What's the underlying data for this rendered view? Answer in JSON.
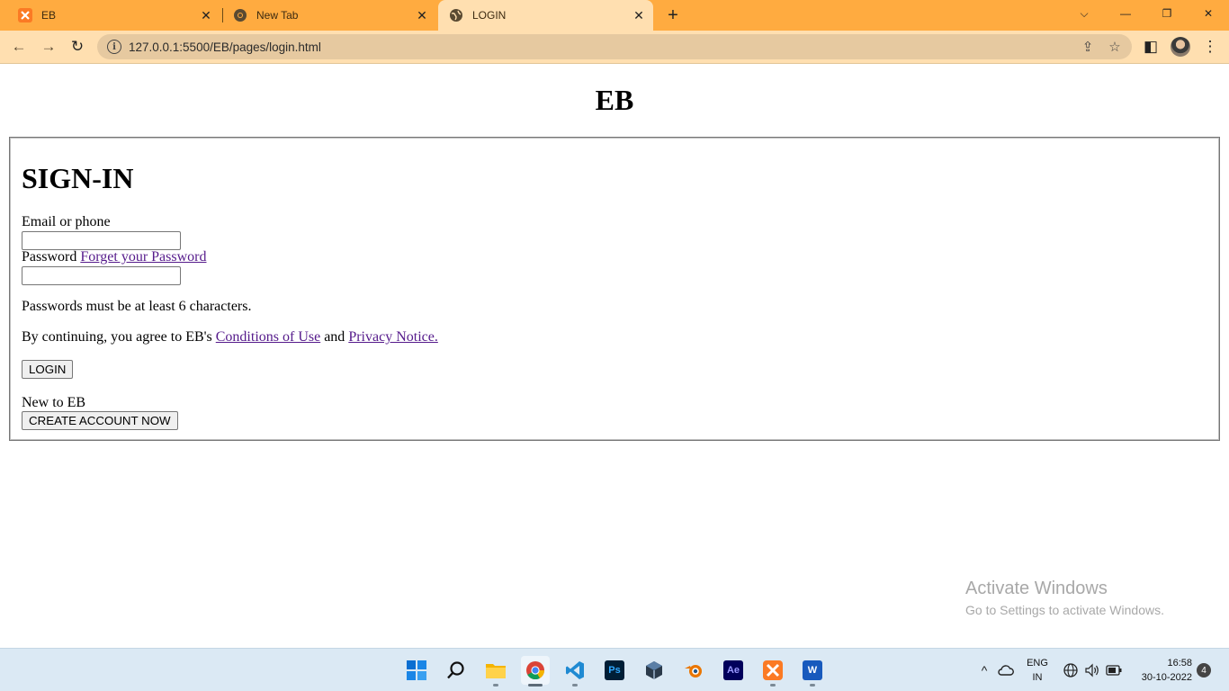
{
  "browser": {
    "tabs": [
      {
        "title": "EB",
        "active": false
      },
      {
        "title": "New Tab",
        "active": false
      },
      {
        "title": "LOGIN",
        "active": true
      }
    ],
    "close_glyph": "✕",
    "new_tab_glyph": "+",
    "url": "127.0.0.1:5500/EB/pages/login.html",
    "window_controls": {
      "tab_search": "⌵",
      "minimize": "—",
      "restore": "❐",
      "close": "✕"
    },
    "nav": {
      "back": "←",
      "forward": "→",
      "reload": "↻"
    },
    "omni_icons": {
      "share": "⇪",
      "bookmark": "☆"
    },
    "side_panel": "◧",
    "menu": "⋮",
    "theme_color": "#ffab40"
  },
  "page": {
    "site_title": "EB",
    "heading": "SIGN-IN",
    "email_label": "Email or phone",
    "email_value": "",
    "password_label": "Password",
    "forgot_link": "Forget your Password",
    "password_value": "",
    "password_hint": "Passwords must be at least 6 characters.",
    "terms_prefix": "By continuing, you agree to EB's",
    "terms_link": "Conditions of Use",
    "terms_and": "and",
    "privacy_link": "Privacy Notice.",
    "login_button": "LOGIN",
    "new_user_text": "New to EB",
    "create_button": "CREATE ACCOUNT NOW",
    "link_color": "#551a8b"
  },
  "watermark": {
    "title": "Activate Windows",
    "subtitle": "Go to Settings to activate Windows."
  },
  "taskbar": {
    "apps": [
      {
        "name": "start"
      },
      {
        "name": "search"
      },
      {
        "name": "file-explorer"
      },
      {
        "name": "chrome"
      },
      {
        "name": "vscode"
      },
      {
        "name": "photoshop",
        "label": "Ps"
      },
      {
        "name": "virtualbox"
      },
      {
        "name": "blender"
      },
      {
        "name": "after-effects",
        "label": "Ae"
      },
      {
        "name": "xampp"
      },
      {
        "name": "word",
        "label": "W"
      }
    ],
    "tray": {
      "chevron": "^",
      "language_line1": "ENG",
      "language_line2": "IN",
      "time": "16:58",
      "date": "30-10-2022",
      "notification_count": "4"
    }
  }
}
